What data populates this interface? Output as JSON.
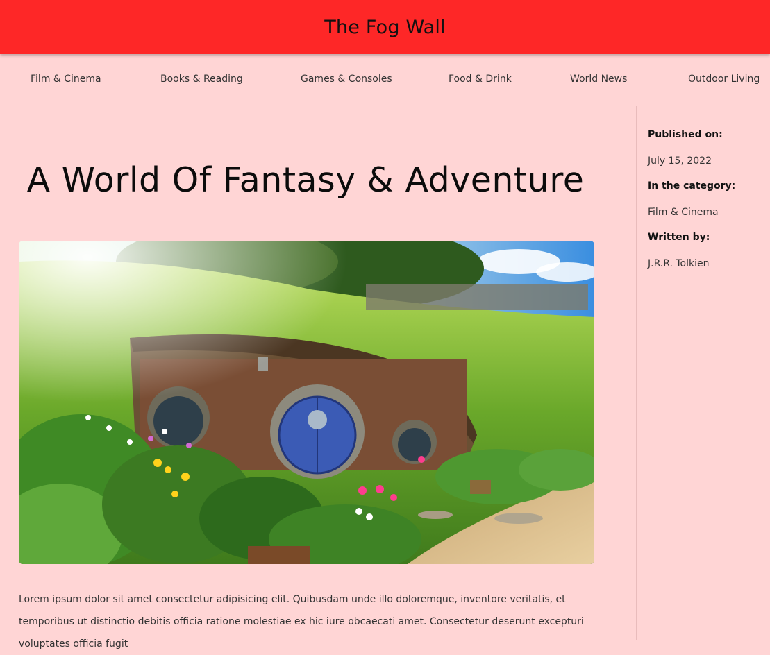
{
  "header": {
    "site_title": "The Fog Wall"
  },
  "nav": {
    "items": [
      {
        "label": "Film & Cinema"
      },
      {
        "label": "Books & Reading"
      },
      {
        "label": "Games & Consoles"
      },
      {
        "label": "Food & Drink"
      },
      {
        "label": "World News"
      },
      {
        "label": "Outdoor Living"
      }
    ]
  },
  "article": {
    "title": "A World Of Fantasy & Adventure",
    "body": "Lorem ipsum dolor sit amet consectetur adipisicing elit. Quibusdam unde illo doloremque, inventore veritatis, et temporibus ut distinctio debitis officia ratione molestiae ex hic iure obcaecati amet. Consectetur deserunt excepturi voluptates officia fugit"
  },
  "sidebar": {
    "published_label": "Published on:",
    "published_value": "July 15, 2022",
    "category_label": "In the category:",
    "category_value": "Film & Cinema",
    "author_label": "Written by:",
    "author_value": "J.R.R. Tolkien"
  },
  "colors": {
    "header_bg": "#fe2727",
    "page_bg": "#ffd5d5"
  }
}
